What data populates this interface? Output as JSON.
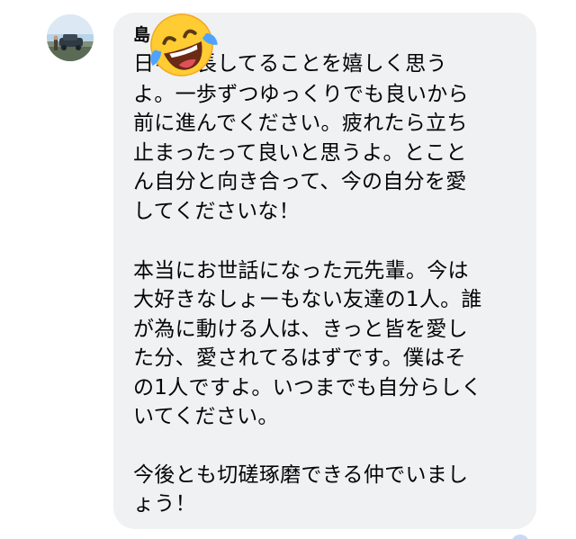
{
  "message": {
    "sender_name": "島",
    "lines": [
      "日々成長してることを嬉しく思う",
      "よ。一歩ずつゆっくりでも良いから",
      "前に進んでください。疲れたら立ち",
      "止まったって良いと思うよ。とこと",
      "ん自分と向き合って、今の自分を愛",
      "してくださいな！",
      "",
      "本当にお世話になった元先輩。今は",
      "大好きなしょーもない友達の1人。誰",
      "が為に動ける人は、きっと皆を愛し",
      "た分、愛されてるはずです。僕はそ",
      "の1人ですよ。いつまでも自分らしく",
      "いてください。",
      "",
      "今後とも切磋琢磨できる仲でいまし",
      "ょう！"
    ]
  },
  "reaction": {
    "icon": "laughing-tears-emoji-icon"
  },
  "colors": {
    "bubble": "#f0f1f3",
    "text": "#050505",
    "emoji_face": "#ffcc33",
    "emoji_tears": "#4da3ff"
  }
}
